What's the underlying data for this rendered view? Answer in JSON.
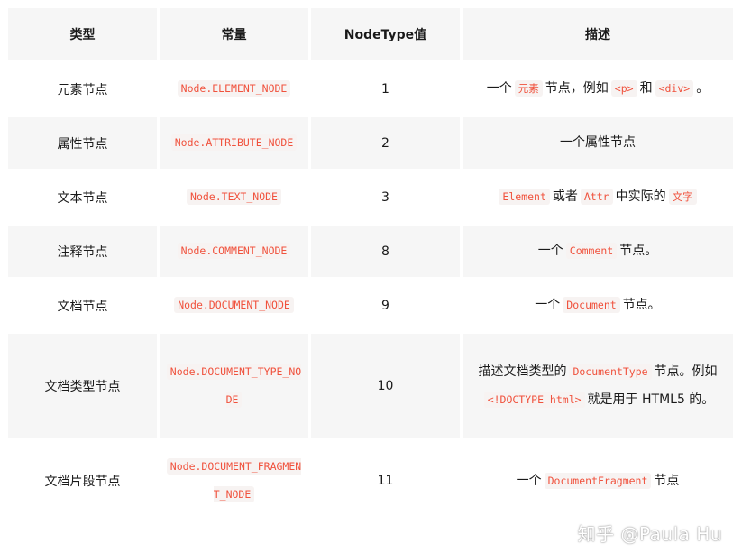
{
  "headers": [
    "类型",
    "常量",
    "NodeType值",
    "描述"
  ],
  "rows": [
    {
      "type": "元素节点",
      "constant": "Node.ELEMENT_NODE",
      "value": "1",
      "desc": [
        {
          "t": "text",
          "v": "一个"
        },
        {
          "t": "code",
          "v": "元素"
        },
        {
          "t": "text",
          "v": "节点，例如"
        },
        {
          "t": "code",
          "v": "<p>"
        },
        {
          "t": "text",
          "v": "和"
        },
        {
          "t": "code",
          "v": "<div>"
        },
        {
          "t": "text",
          "v": "。"
        }
      ]
    },
    {
      "type": "属性节点",
      "constant": "Node.ATTRIBUTE_NODE",
      "value": "2",
      "desc": [
        {
          "t": "text",
          "v": "一个属性节点"
        }
      ]
    },
    {
      "type": "文本节点",
      "constant": "Node.TEXT_NODE",
      "value": "3",
      "desc": [
        {
          "t": "code",
          "v": "Element"
        },
        {
          "t": "text",
          "v": "或者"
        },
        {
          "t": "code",
          "v": "Attr"
        },
        {
          "t": "text",
          "v": "中实际的"
        },
        {
          "t": "code",
          "v": "文字"
        }
      ]
    },
    {
      "type": "注释节点",
      "constant": "Node.COMMENT_NODE",
      "value": "8",
      "desc": [
        {
          "t": "text",
          "v": "一个"
        },
        {
          "t": "code",
          "v": "Comment"
        },
        {
          "t": "text",
          "v": "节点。"
        }
      ]
    },
    {
      "type": "文档节点",
      "constant": "Node.DOCUMENT_NODE",
      "value": "9",
      "desc": [
        {
          "t": "text",
          "v": "一个"
        },
        {
          "t": "code",
          "v": "Document"
        },
        {
          "t": "text",
          "v": "节点。"
        }
      ]
    },
    {
      "type": "文档类型节点",
      "constant": "Node.DOCUMENT_TYPE_NODE",
      "value": "10",
      "desc": [
        {
          "t": "text",
          "v": "描述文档类型的"
        },
        {
          "t": "code",
          "v": "DocumentType"
        },
        {
          "t": "text",
          "v": "节点。例如"
        },
        {
          "t": "code",
          "v": "<!DOCTYPE html>"
        },
        {
          "t": "text",
          "v": "就是用于 HTML5 的。"
        }
      ]
    },
    {
      "type": "文档片段节点",
      "constant": "Node.DOCUMENT_FRAGMENT_NODE",
      "value": "11",
      "desc": [
        {
          "t": "text",
          "v": "一个"
        },
        {
          "t": "code",
          "v": "DocumentFragment"
        },
        {
          "t": "text",
          "v": "节点"
        }
      ]
    }
  ],
  "watermark": "知乎 @Paula Hu"
}
